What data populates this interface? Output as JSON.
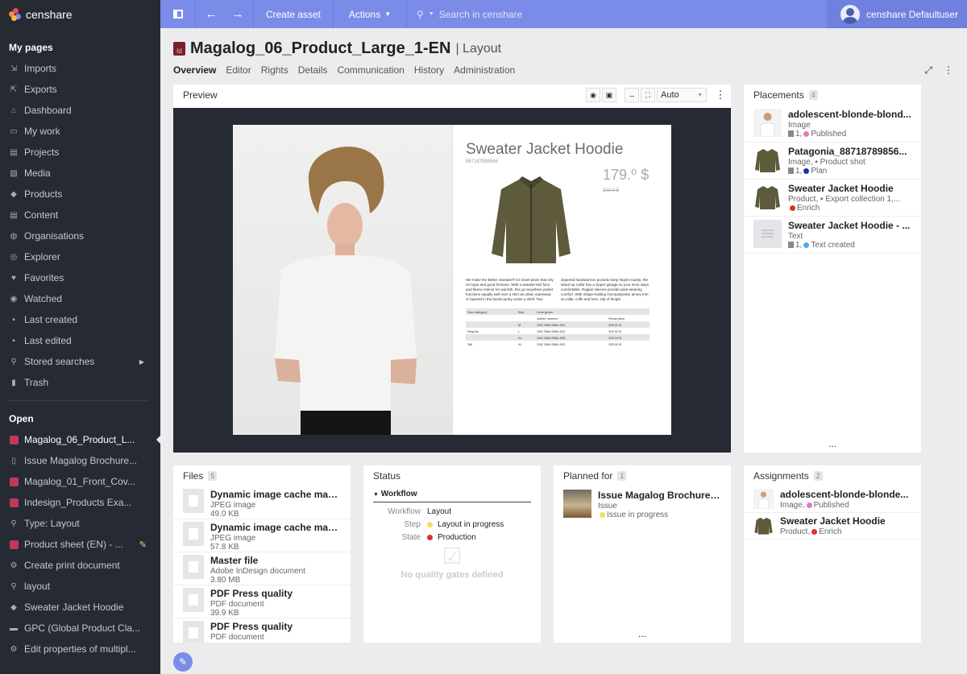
{
  "app": {
    "logo_text": "censhare"
  },
  "sidebar": {
    "my_pages_title": "My pages",
    "my_pages": [
      {
        "label": "Imports",
        "icon": "import-icon"
      },
      {
        "label": "Exports",
        "icon": "export-icon"
      },
      {
        "label": "Dashboard",
        "icon": "home-icon"
      },
      {
        "label": "My work",
        "icon": "inbox-icon"
      },
      {
        "label": "Projects",
        "icon": "project-icon"
      },
      {
        "label": "Media",
        "icon": "image-icon"
      },
      {
        "label": "Products",
        "icon": "cube-icon"
      },
      {
        "label": "Content",
        "icon": "document-icon"
      },
      {
        "label": "Organisations",
        "icon": "globe-icon"
      },
      {
        "label": "Explorer",
        "icon": "compass-icon"
      },
      {
        "label": "Favorites",
        "icon": "heart-icon"
      },
      {
        "label": "Watched",
        "icon": "eye-icon"
      },
      {
        "label": "Last created",
        "icon": "file-icon"
      },
      {
        "label": "Last edited",
        "icon": "file-icon"
      },
      {
        "label": "Stored searches",
        "icon": "search-icon"
      },
      {
        "label": "Trash",
        "icon": "trash-icon"
      }
    ],
    "open_title": "Open",
    "open_items": [
      {
        "label": "Magalog_06_Product_L...",
        "icon": "indesign-icon"
      },
      {
        "label": "Issue Magalog Brochure...",
        "icon": "book-icon"
      },
      {
        "label": "Magalog_01_Front_Cov...",
        "icon": "indesign-icon"
      },
      {
        "label": "Indesign_Products Exa...",
        "icon": "indesign-icon"
      },
      {
        "label": "Type: Layout",
        "icon": "search-icon"
      },
      {
        "label": "Product sheet (EN) - ...",
        "icon": "indesign-icon"
      },
      {
        "label": "Create print document",
        "icon": "gear-icon"
      },
      {
        "label": "layout",
        "icon": "search-icon"
      },
      {
        "label": "Sweater Jacket Hoodie",
        "icon": "cube-icon"
      },
      {
        "label": "GPC (Global Product Cla...",
        "icon": "folder-icon"
      },
      {
        "label": "Edit properties of multipl...",
        "icon": "gear-icon"
      }
    ]
  },
  "topbar": {
    "create_asset": "Create asset",
    "actions": "Actions",
    "search_placeholder": "Search in censhare",
    "user_name": "censhare Defaultuser"
  },
  "header": {
    "title": "Magalog_06_Product_Large_1-EN",
    "subtitle": "| Layout",
    "icon_text": "Id",
    "tabs": [
      "Overview",
      "Editor",
      "Rights",
      "Details",
      "Communication",
      "History",
      "Administration"
    ]
  },
  "preview": {
    "title": "Preview",
    "zoom": "Auto",
    "page": {
      "product_title": "Sweater Jacket Hoodie",
      "sku": "887187898565",
      "price": "179.⁰ $",
      "old_price": "200.0 $",
      "text_left": "We make the Better Sweater® for travel plans that rely on hope and good fortunes. With a sweater-knit face and fleece interior for warmth, this go-anywhere jacket functions equally well over a shirt as urban outerwear or layered in the backcountry under a shell. Two",
      "text_right": "zippered handwarmer pockets keep fingers toasty; the stand-up collar has a zipper garage so your neck stays comfortable. Raglan sleeves provide pack-wearing comfort. With shape-holding micropolyester jersey trim at collar, cuffs and hem. Hip of length.",
      "table": [
        [
          "Size category",
          "Size",
          "Lime green",
          ""
        ],
        [
          "",
          "",
          "Article number",
          "Retail price"
        ],
        [
          "",
          "M",
          "256-7884-5564-001",
          "200.00 $"
        ],
        [
          "Regular",
          "L",
          "256-7884-5564-002",
          "200.00 $"
        ],
        [
          "",
          "XL",
          "256-7884-5564-003",
          "200.00 $"
        ],
        [
          "Tall",
          "XL",
          "256-7884-5564-003",
          "200.00 $"
        ]
      ]
    }
  },
  "placements": {
    "title": "Placements",
    "count": "4",
    "items": [
      {
        "title": "adolescent-blonde-blond...",
        "type": "Image",
        "meta": "1,",
        "state": "Published",
        "state_color": "#e07ac2"
      },
      {
        "title": "Patagonia_88718789856...",
        "type": "Image, ▪ Product shot",
        "meta": "1,",
        "state": "Plan",
        "state_color": "#1a2fbf"
      },
      {
        "title": "Sweater Jacket Hoodie",
        "type": "Product, ▪ Export collection 1,...",
        "meta": "",
        "state": "Enrich",
        "state_color": "#d9342b"
      },
      {
        "title": "Sweater Jacket Hoodie - ...",
        "type": "Text",
        "meta": "1,",
        "state": "Text created",
        "state_color": "#54a8e8"
      }
    ]
  },
  "files": {
    "title": "Files",
    "count": "5",
    "items": [
      {
        "name": "Dynamic image cache mast...",
        "type": "JPEG image",
        "size": "49.0 KB"
      },
      {
        "name": "Dynamic image cache mast...",
        "type": "JPEG image",
        "size": "57.8 KB"
      },
      {
        "name": "Master file",
        "type": "Adobe InDesign document",
        "size": "3.80 MB"
      },
      {
        "name": "PDF Press quality",
        "type": "PDF document",
        "size": "39.9 KB"
      },
      {
        "name": "PDF Press quality",
        "type": "PDF document",
        "size": ""
      }
    ]
  },
  "status": {
    "title": "Status",
    "section": "Workflow",
    "rows": [
      {
        "label": "Workflow",
        "value": "Layout",
        "color": ""
      },
      {
        "label": "Step",
        "value": "Layout in progress",
        "color": "#f2dd63"
      },
      {
        "label": "State",
        "value": "Production",
        "color": "#d9342b"
      }
    ],
    "empty": "No quality gates defined"
  },
  "planned": {
    "title": "Planned for",
    "count": "1",
    "item": {
      "title": "Issue Magalog Brochure-...",
      "type": "Issue",
      "state": "Issue in progress",
      "state_color": "#f2dd63"
    }
  },
  "assignments": {
    "title": "Assignments",
    "count": "2",
    "items": [
      {
        "title": "adolescent-blonde-blonde...",
        "type": "Image,",
        "state": "Published",
        "state_color": "#e07ac2"
      },
      {
        "title": "Sweater Jacket Hoodie",
        "type": "Product,",
        "state": "Enrich",
        "state_color": "#d9342b"
      }
    ]
  }
}
